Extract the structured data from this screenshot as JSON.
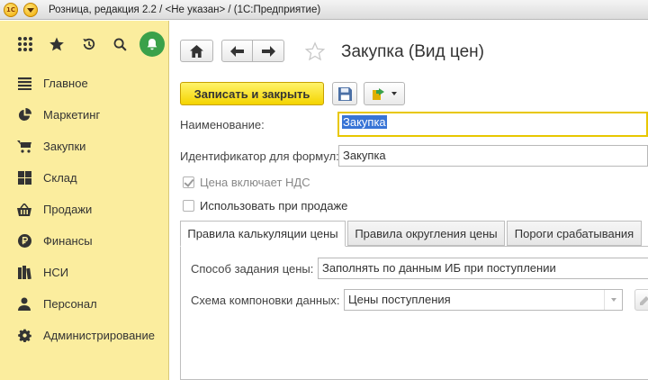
{
  "window": {
    "logo_text": "1С",
    "title": "Розница, редакция 2.2 / <Не указан> / (1С:Предприятие)"
  },
  "sidebar": {
    "items": [
      {
        "label": "Главное",
        "icon": "menu-lines-icon"
      },
      {
        "label": "Маркетинг",
        "icon": "pie-chart-icon"
      },
      {
        "label": "Закупки",
        "icon": "cart-icon"
      },
      {
        "label": "Склад",
        "icon": "warehouse-grid-icon"
      },
      {
        "label": "Продажи",
        "icon": "basket-icon"
      },
      {
        "label": "Финансы",
        "icon": "ruble-coin-icon"
      },
      {
        "label": "НСИ",
        "icon": "books-icon"
      },
      {
        "label": "Персонал",
        "icon": "person-icon"
      },
      {
        "label": "Администрирование",
        "icon": "gear-icon"
      }
    ],
    "accent_color": "#fbed9e"
  },
  "form": {
    "title": "Закупка (Вид цен)",
    "save_close_label": "Записать и закрыть",
    "name_label": "Наименование:",
    "name_value": "Закупка",
    "formula_id_label": "Идентификатор для формул:",
    "formula_id_value": "Закупка",
    "vat_included_label": "Цена включает НДС",
    "vat_included_checked": true,
    "use_in_sales_label": "Использовать при продаже",
    "use_in_sales_checked": false
  },
  "tabs": [
    {
      "label": "Правила калькуляции цены",
      "active": true
    },
    {
      "label": "Правила округления цены",
      "active": false
    },
    {
      "label": "Пороги срабатывания",
      "active": false
    }
  ],
  "tab_content": {
    "price_method_label": "Способ задания цены:",
    "price_method_value": "Заполнять по данным ИБ при поступлении",
    "schema_label": "Схема компоновки данных:",
    "schema_value": "Цены поступления"
  }
}
